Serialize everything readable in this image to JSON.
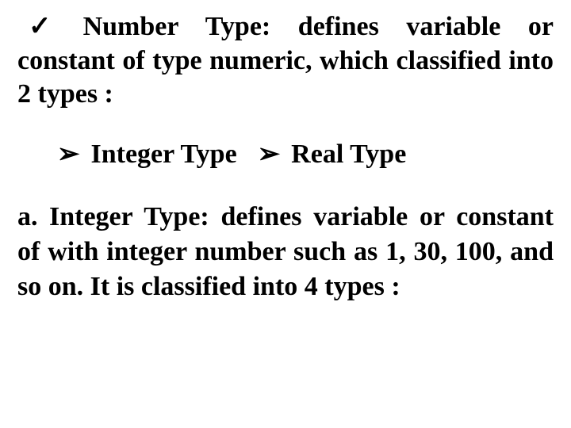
{
  "section1": {
    "bullet": "✓",
    "text": "Number Type: defines variable or constant of type numeric, which classified into 2 types :"
  },
  "subtypes": {
    "arrow": "➢",
    "item1": "Integer Type",
    "item2": "Real Type"
  },
  "section2": {
    "lead": "a.",
    "text": "Integer Type: defines variable or constant of with integer number such as 1, 30, 100, and so on. It is classified into 4 types :"
  }
}
